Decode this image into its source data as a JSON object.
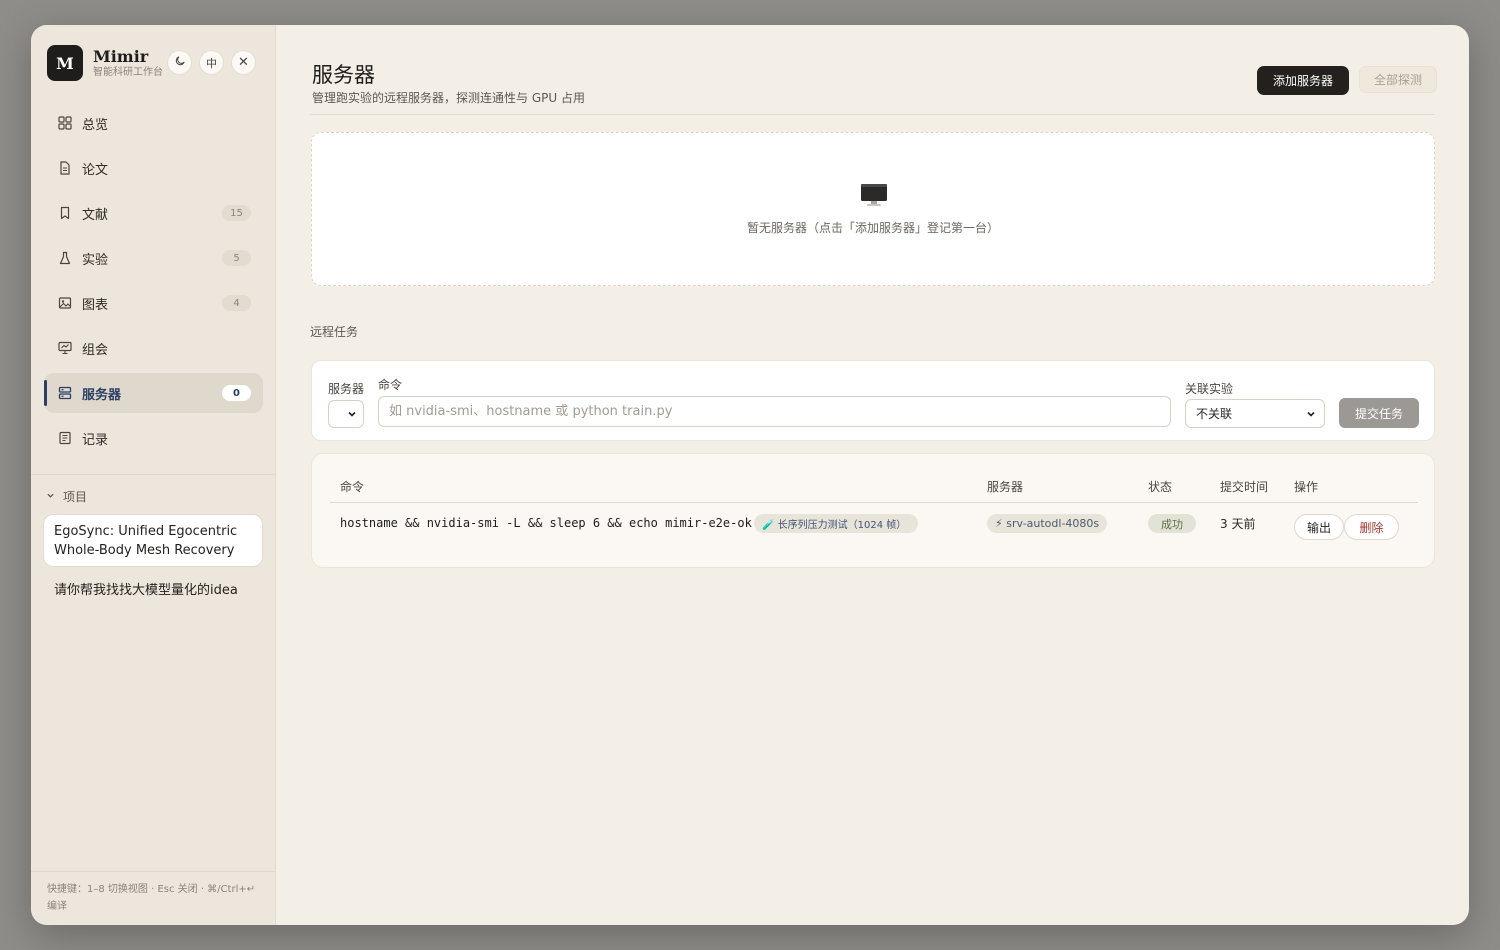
{
  "brand": {
    "logo_letter": "M",
    "name": "Mimir",
    "subtitle": "智能科研工作台"
  },
  "header_buttons": [
    {
      "name": "theme-toggle",
      "icon": "moon-icon",
      "label": ""
    },
    {
      "name": "language-toggle",
      "icon": "",
      "label": "中"
    },
    {
      "name": "close",
      "icon": "close-icon",
      "label": "✕"
    }
  ],
  "nav": {
    "items": [
      {
        "label": "总览",
        "icon": "grid-icon",
        "badge": ""
      },
      {
        "label": "论文",
        "icon": "document-icon",
        "badge": ""
      },
      {
        "label": "文献",
        "icon": "bookmark-icon",
        "badge": "15"
      },
      {
        "label": "实验",
        "icon": "flask-icon",
        "badge": "5"
      },
      {
        "label": "图表",
        "icon": "image-icon",
        "badge": "4"
      },
      {
        "label": "组会",
        "icon": "presentation-icon",
        "badge": ""
      },
      {
        "label": "服务器",
        "icon": "server-icon",
        "badge": "0",
        "active": true
      },
      {
        "label": "记录",
        "icon": "notes-icon",
        "badge": ""
      }
    ]
  },
  "projects": {
    "header": "项目",
    "items": [
      {
        "title": "EgoSync: Unified Egocentric Whole-Body Mesh Recovery",
        "selected": true
      },
      {
        "title": "请你帮我找找大模型量化的idea",
        "selected": false
      }
    ]
  },
  "shortcut_hint": "快捷键：1–8 切换视图 · Esc 关闭 · ⌘/Ctrl+↵ 编译",
  "page": {
    "title": "服务器",
    "subtitle": "管理跑实验的远程服务器，探测连通性与 GPU 占用",
    "add_server_label": "添加服务器",
    "probe_all_label": "全部探测"
  },
  "empty_state": {
    "icon": "monitor-icon",
    "text": "暂无服务器（点击「添加服务器」登记第一台）"
  },
  "remote_tasks": {
    "section_label": "远程任务",
    "form": {
      "server_label": "服务器",
      "command_label": "命令",
      "command_placeholder": "如 nvidia-smi、hostname 或 python train.py",
      "experiment_label": "关联实验",
      "experiment_selected": "不关联",
      "submit_label": "提交任务"
    },
    "table": {
      "headers": {
        "command": "命令",
        "server": "服务器",
        "status": "状态",
        "submitted": "提交时间",
        "actions": "操作"
      },
      "rows": [
        {
          "command": "hostname && nvidia-smi -L && sleep 6 && echo mimir-e2e-ok",
          "experiment_chip": "🧪 长序列压力测试（1024 帧）",
          "server_chip": "⚡ srv-autodl-4080s",
          "status": "成功",
          "submitted": "3 天前",
          "output_label": "输出",
          "delete_label": "删除"
        }
      ]
    }
  },
  "colors": {
    "accent": "#2b3f63",
    "danger": "#a33a2f",
    "success": "#5b7049",
    "primary_button": "#23201d"
  }
}
